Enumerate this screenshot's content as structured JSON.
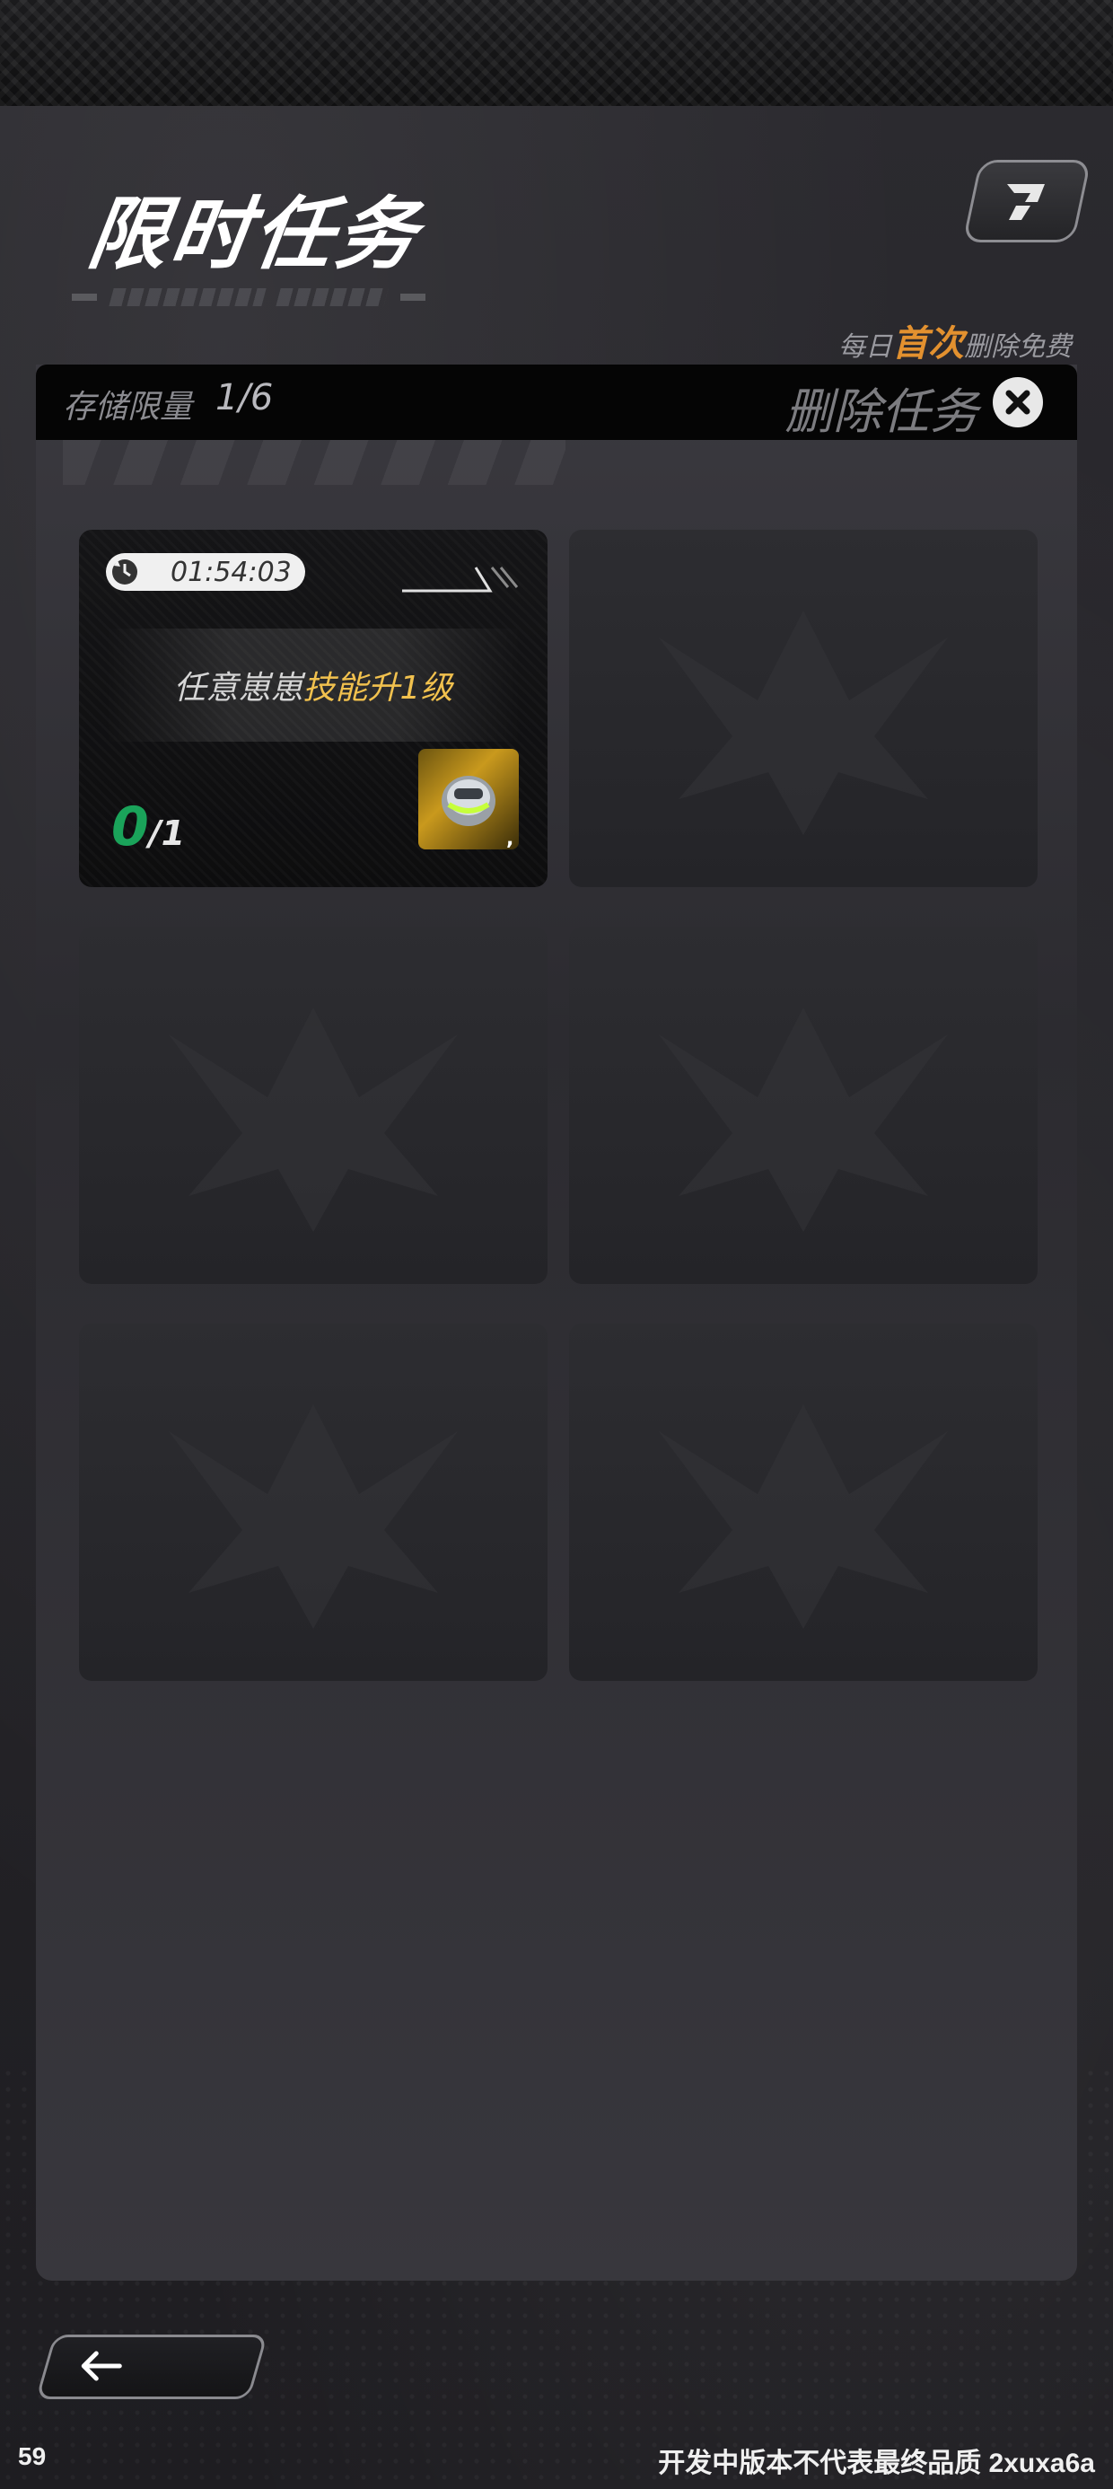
{
  "header": {
    "title": "限时任务",
    "daily_note_prefix": "每日",
    "daily_note_highlight": "首次",
    "daily_note_suffix": "删除免费",
    "help_icon": "help-tag-icon"
  },
  "panel": {
    "capacity_label": "存储限量",
    "capacity_value": "1/6",
    "delete_label": "删除任务",
    "delete_icon": "close-icon"
  },
  "task": {
    "timer": "01:54:03",
    "timer_icon": "refresh-clock-icon",
    "desc_plain": "任意崽崽",
    "desc_highlight": "技能升1级",
    "progress_current": "0",
    "progress_separator": "/",
    "progress_total": "1",
    "reward_icon": "helmet-item-icon",
    "reward_count": ","
  },
  "slots": {
    "empty_count": 5,
    "empty_icon": "emblem-placeholder-icon"
  },
  "footer": {
    "back_icon": "arrow-left-icon",
    "fps": "59",
    "build_note": "开发中版本不代表最终品质 2xuxa6a"
  },
  "colors": {
    "highlight_orange": "#e3912f",
    "highlight_gold": "#f1c14e",
    "progress_green": "#1aa35a"
  }
}
